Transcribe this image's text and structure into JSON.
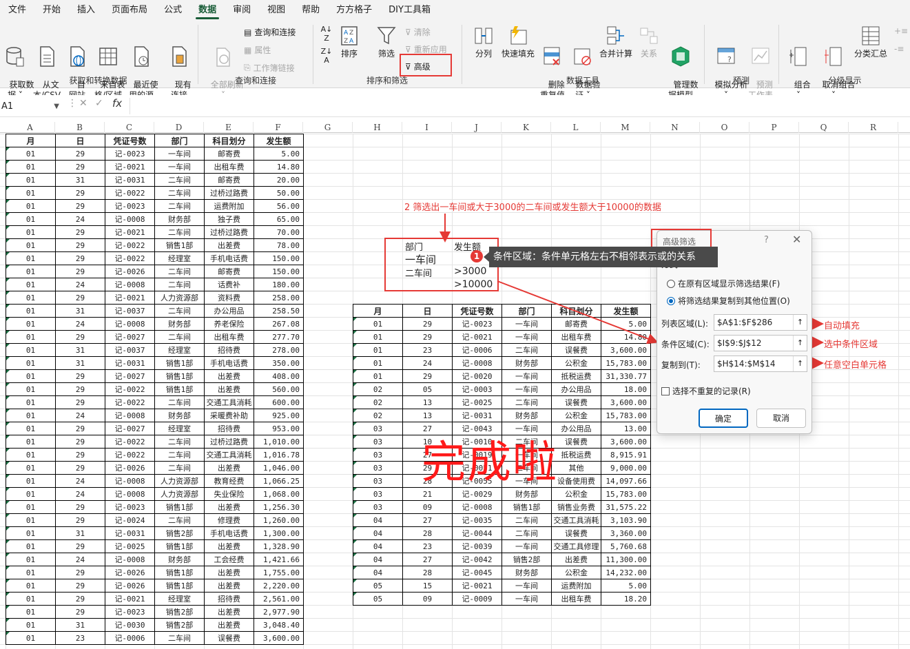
{
  "menu": [
    "文件",
    "开始",
    "插入",
    "页面布局",
    "公式",
    "数据",
    "审阅",
    "视图",
    "帮助",
    "方方格子",
    "DIY工具箱"
  ],
  "ribbon": {
    "get_data": {
      "label": "获取和转换数据",
      "btn1": "获取数\n据 ˅",
      "btn2": "从文\n本/CSV",
      "btn3": "自\n网站",
      "btn4": "来自表\n格/区域",
      "btn5": "最近使\n用的源",
      "btn6": "现有\n连接"
    },
    "queries": {
      "label": "查询和连接",
      "refresh": "全部刷新\n˅",
      "queries_conn": "查询和连接",
      "properties": "属性",
      "edit_links": "工作簿链接"
    },
    "sort_filter": {
      "label": "排序和筛选",
      "sort": "排序",
      "filter": "筛选",
      "clear": "清除",
      "reapply": "重新应用",
      "advanced": "高级"
    },
    "data_tools": {
      "label": "数据工具",
      "split": "分列",
      "flash": "快速填充",
      "dup": "删除\n重复值",
      "validate": "数据验\n证 ˅",
      "consolidate": "合并计算",
      "relations": "关系",
      "model": "管理数\n据模型"
    },
    "forecast": {
      "label": "预测",
      "whatif": "模拟分析\n˅",
      "sheet": "预测\n工作表"
    },
    "outline": {
      "label": "分级显示",
      "group": "组合\n˅",
      "ungroup": "取消组合\n˅",
      "subtotal": "分类汇总"
    }
  },
  "formula_bar": {
    "name_box": "A1",
    "fx": "fx",
    "formula": ""
  },
  "columns": [
    "A",
    "B",
    "C",
    "D",
    "E",
    "F",
    "G",
    "H",
    "I",
    "J",
    "K",
    "L",
    "M",
    "N",
    "O",
    "P",
    "Q",
    "R"
  ],
  "left_table": {
    "headers": [
      "月",
      "日",
      "凭证号数",
      "部门",
      "科目划分",
      "发生额"
    ],
    "rows": [
      [
        "01",
        "29",
        "记-0023",
        "一车间",
        "邮寄费",
        "5.00"
      ],
      [
        "01",
        "29",
        "记-0021",
        "一车间",
        "出租车费",
        "14.80"
      ],
      [
        "01",
        "31",
        "记-0031",
        "二车间",
        "邮寄费",
        "20.00"
      ],
      [
        "01",
        "29",
        "记-0022",
        "二车间",
        "过桥过路费",
        "50.00"
      ],
      [
        "01",
        "29",
        "记-0023",
        "二车间",
        "运费附加",
        "56.00"
      ],
      [
        "01",
        "24",
        "记-0008",
        "财务部",
        "独子费",
        "65.00"
      ],
      [
        "01",
        "29",
        "记-0021",
        "二车间",
        "过桥过路费",
        "70.00"
      ],
      [
        "01",
        "29",
        "记-0022",
        "销售1部",
        "出差费",
        "78.00"
      ],
      [
        "01",
        "29",
        "记-0022",
        "经理室",
        "手机电话费",
        "150.00"
      ],
      [
        "01",
        "29",
        "记-0026",
        "二车间",
        "邮寄费",
        "150.00"
      ],
      [
        "01",
        "24",
        "记-0008",
        "二车间",
        "话费补",
        "180.00"
      ],
      [
        "01",
        "29",
        "记-0021",
        "人力资源部",
        "资料费",
        "258.00"
      ],
      [
        "01",
        "31",
        "记-0037",
        "二车间",
        "办公用品",
        "258.50"
      ],
      [
        "01",
        "24",
        "记-0008",
        "财务部",
        "养老保险",
        "267.08"
      ],
      [
        "01",
        "29",
        "记-0027",
        "二车间",
        "出租车费",
        "277.70"
      ],
      [
        "01",
        "31",
        "记-0037",
        "经理室",
        "招待费",
        "278.00"
      ],
      [
        "01",
        "31",
        "记-0031",
        "销售1部",
        "手机电话费",
        "350.00"
      ],
      [
        "01",
        "29",
        "记-0027",
        "销售1部",
        "出差费",
        "408.00"
      ],
      [
        "01",
        "29",
        "记-0022",
        "销售1部",
        "出差费",
        "560.00"
      ],
      [
        "01",
        "29",
        "记-0022",
        "二车间",
        "交通工具消耗",
        "600.00"
      ],
      [
        "01",
        "24",
        "记-0008",
        "财务部",
        "采暖费补助",
        "925.00"
      ],
      [
        "01",
        "29",
        "记-0027",
        "经理室",
        "招待费",
        "953.00"
      ],
      [
        "01",
        "29",
        "记-0022",
        "二车间",
        "过桥过路费",
        "1,010.00"
      ],
      [
        "01",
        "29",
        "记-0022",
        "二车间",
        "交通工具消耗",
        "1,016.78"
      ],
      [
        "01",
        "29",
        "记-0026",
        "二车间",
        "出差费",
        "1,046.00"
      ],
      [
        "01",
        "24",
        "记-0008",
        "人力资源部",
        "教育经费",
        "1,066.25"
      ],
      [
        "01",
        "24",
        "记-0008",
        "人力资源部",
        "失业保险",
        "1,068.00"
      ],
      [
        "01",
        "29",
        "记-0023",
        "销售1部",
        "出差费",
        "1,256.30"
      ],
      [
        "01",
        "29",
        "记-0024",
        "二车间",
        "修理费",
        "1,260.00"
      ],
      [
        "01",
        "31",
        "记-0031",
        "销售2部",
        "手机电话费",
        "1,300.00"
      ],
      [
        "01",
        "29",
        "记-0025",
        "销售1部",
        "出差费",
        "1,328.90"
      ],
      [
        "01",
        "24",
        "记-0008",
        "财务部",
        "工会经费",
        "1,421.66"
      ],
      [
        "01",
        "29",
        "记-0026",
        "销售1部",
        "出差费",
        "1,755.00"
      ],
      [
        "01",
        "29",
        "记-0026",
        "销售1部",
        "出差费",
        "2,220.00"
      ],
      [
        "01",
        "29",
        "记-0021",
        "经理室",
        "招待费",
        "2,561.00"
      ],
      [
        "01",
        "29",
        "记-0023",
        "销售2部",
        "出差费",
        "2,977.90"
      ],
      [
        "01",
        "31",
        "记-0030",
        "销售2部",
        "出差费",
        "3,048.40"
      ],
      [
        "01",
        "23",
        "记-0006",
        "二车间",
        "误餐费",
        "3,600.00"
      ]
    ]
  },
  "criteria": {
    "h1": "部门",
    "h2": "发生额",
    "r1": "一车间",
    "r2a": "二车间",
    "r2b": ">3000",
    "r3": ">10000"
  },
  "annotation": "2 筛选出一车间或大于3000的二车间或发生额大于10000的数据",
  "tooltip": {
    "badge": "1",
    "text": "条件区域：条件单元格左右不相邻表示或的关系"
  },
  "result_table": {
    "headers": [
      "月",
      "日",
      "凭证号数",
      "部门",
      "科目划分",
      "发生额"
    ],
    "rows": [
      [
        "01",
        "29",
        "记-0023",
        "一车间",
        "邮寄费",
        "5.00"
      ],
      [
        "01",
        "29",
        "记-0021",
        "一车间",
        "出租车费",
        "14.80"
      ],
      [
        "01",
        "23",
        "记-0006",
        "二车间",
        "误餐费",
        "3,600.00"
      ],
      [
        "01",
        "24",
        "记-0008",
        "财务部",
        "公积金",
        "15,783.00"
      ],
      [
        "01",
        "29",
        "记-0020",
        "一车间",
        "抵税运费",
        "31,330.77"
      ],
      [
        "02",
        "05",
        "记-0003",
        "一车间",
        "办公用品",
        "18.00"
      ],
      [
        "02",
        "13",
        "记-0025",
        "二车间",
        "误餐费",
        "3,600.00"
      ],
      [
        "02",
        "13",
        "记-0031",
        "财务部",
        "公积金",
        "15,783.00"
      ],
      [
        "03",
        "27",
        "记-0043",
        "一车间",
        "办公用品",
        "13.00"
      ],
      [
        "03",
        "10",
        "记-0010",
        "二车间",
        "误餐费",
        "3,600.00"
      ],
      [
        "03",
        "27",
        "记-0019",
        "一车间",
        "抵税运费",
        "8,915.91"
      ],
      [
        "03",
        "29",
        "记-0051",
        "二车间",
        "其他",
        "9,000.00"
      ],
      [
        "03",
        "28",
        "记-0055",
        "一车间",
        "设备使用费",
        "14,097.66"
      ],
      [
        "03",
        "21",
        "记-0029",
        "财务部",
        "公积金",
        "15,783.00"
      ],
      [
        "03",
        "09",
        "记-0008",
        "销售1部",
        "销售业务费",
        "31,575.22"
      ],
      [
        "04",
        "27",
        "记-0035",
        "二车间",
        "交通工具消耗",
        "3,103.90"
      ],
      [
        "04",
        "28",
        "记-0044",
        "二车间",
        "误餐费",
        "3,360.00"
      ],
      [
        "04",
        "23",
        "记-0039",
        "一车间",
        "交通工具修理",
        "5,760.68"
      ],
      [
        "04",
        "27",
        "记-0042",
        "销售2部",
        "出差费",
        "11,300.00"
      ],
      [
        "04",
        "28",
        "记-0045",
        "财务部",
        "公积金",
        "14,232.00"
      ],
      [
        "05",
        "15",
        "记-0021",
        "一车间",
        "运费附加",
        "5.00"
      ],
      [
        "05",
        "09",
        "记-0009",
        "一车间",
        "出租车费",
        "18.20"
      ]
    ]
  },
  "done_text": "完成啦",
  "dialog": {
    "title": "高级筛选",
    "help": "?",
    "close": "✕",
    "mode_label": "方式",
    "opt1": "在原有区域显示筛选结果(F)",
    "opt2": "将筛选结果复制到其他位置(O)",
    "list_label": "列表区域(L):",
    "list_value": "$A$1:$F$286",
    "crit_label": "条件区域(C):",
    "crit_value": "$I$9:$J$12",
    "copy_label": "复制到(T):",
    "copy_value": "$H$14:$M$14",
    "unique": "选择不重复的记录(R)",
    "ok": "确定",
    "cancel": "取消"
  },
  "side_notes": {
    "n1": "自动填充",
    "n2": "选中条件区域",
    "n3": "任意空白单元格"
  }
}
